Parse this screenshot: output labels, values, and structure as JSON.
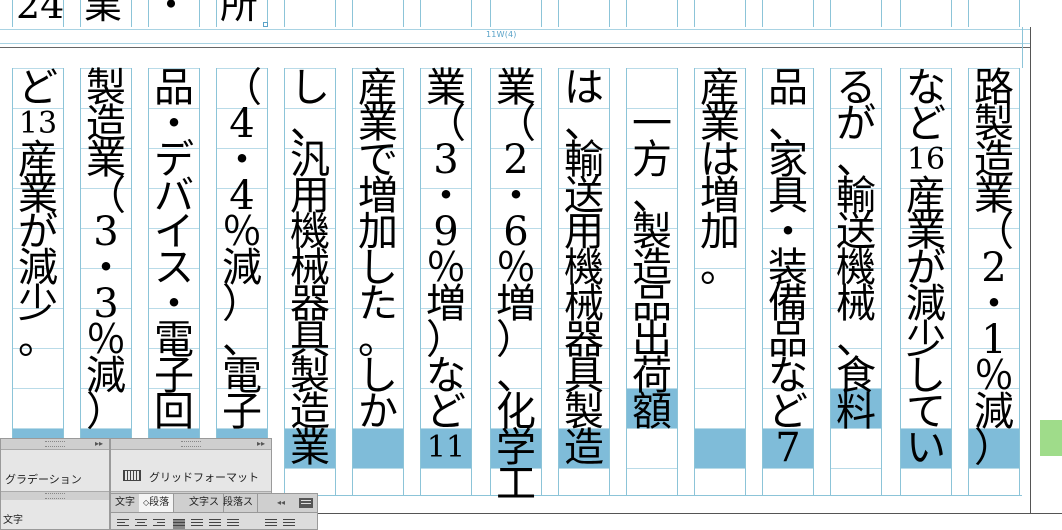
{
  "top_strip": {
    "chars": [
      "24",
      "業",
      "・",
      "所"
    ]
  },
  "grid_label": "11W(4)",
  "columns": [
    {
      "chars": [
        "路",
        "製",
        "造",
        "業",
        "（",
        "2",
        "・",
        "1",
        "％",
        "減",
        "）"
      ],
      "hl": [
        9
      ]
    },
    {
      "chars": [
        "な",
        "ど",
        "16",
        "産",
        "業",
        "が",
        "減",
        "少",
        "し",
        "て",
        "い"
      ],
      "hl": [
        9
      ]
    },
    {
      "chars": [
        "る",
        "が",
        "、",
        "輸",
        "送",
        "機",
        "械",
        "、",
        "食",
        "料"
      ],
      "hl": [
        8
      ]
    },
    {
      "chars": [
        "品",
        "、",
        "家",
        "具",
        "・",
        "装",
        "備",
        "品",
        "な",
        "ど",
        "7"
      ],
      "hl": [
        9
      ]
    },
    {
      "chars": [
        "産",
        "業",
        "は",
        "増",
        "加",
        "。"
      ],
      "hl": [
        9
      ]
    },
    {
      "chars": [
        "",
        "一",
        "方",
        "、",
        "製",
        "造",
        "品",
        "出",
        "荷",
        "額"
      ],
      "hl": [
        8
      ]
    },
    {
      "chars": [
        "は",
        "、",
        "輸",
        "送",
        "用",
        "機",
        "械",
        "器",
        "具",
        "製",
        "造"
      ],
      "hl": [
        9
      ]
    },
    {
      "chars": [
        "業",
        "（",
        "2",
        "・",
        "6",
        "％",
        "増",
        "）",
        "、",
        "化",
        "学",
        "工"
      ],
      "hl": [
        9
      ]
    },
    {
      "chars": [
        "業",
        "（",
        "3",
        "・",
        "9",
        "％",
        "増",
        "）",
        "な",
        "ど",
        "11"
      ],
      "hl": [
        9
      ]
    },
    {
      "chars": [
        "産",
        "業",
        "で",
        "増",
        "加",
        "し",
        "た",
        "。",
        "し",
        "か"
      ],
      "hl": [
        9
      ]
    },
    {
      "chars": [
        "し",
        "、",
        "汎",
        "用",
        "機",
        "械",
        "器",
        "具",
        "製",
        "造",
        "業"
      ],
      "hl": [
        9
      ]
    },
    {
      "chars": [
        "（",
        "4",
        "・",
        "4",
        "％",
        "減",
        "）",
        "、",
        "電",
        "子"
      ],
      "hl": [
        9
      ]
    },
    {
      "chars": [
        "品",
        "・",
        "デ",
        "バ",
        "イ",
        "ス",
        "・",
        "電",
        "子",
        "回"
      ],
      "hl": [
        9
      ]
    },
    {
      "chars": [
        "製",
        "造",
        "業",
        "（",
        "3",
        "・",
        "3",
        "％",
        "減",
        "）"
      ],
      "hl": [
        9
      ]
    },
    {
      "chars": [
        "ど",
        "13",
        "産",
        "業",
        "が",
        "減",
        "少",
        "。"
      ],
      "hl": [
        9
      ]
    }
  ],
  "panels": {
    "left": {
      "gradient_label": "グラデーション",
      "text_label": "文字"
    },
    "right": {
      "grid_format_label": "グリッドフォーマット",
      "tabs": [
        "文字",
        "段落",
        "文字ス",
        "段落ス"
      ]
    }
  }
}
